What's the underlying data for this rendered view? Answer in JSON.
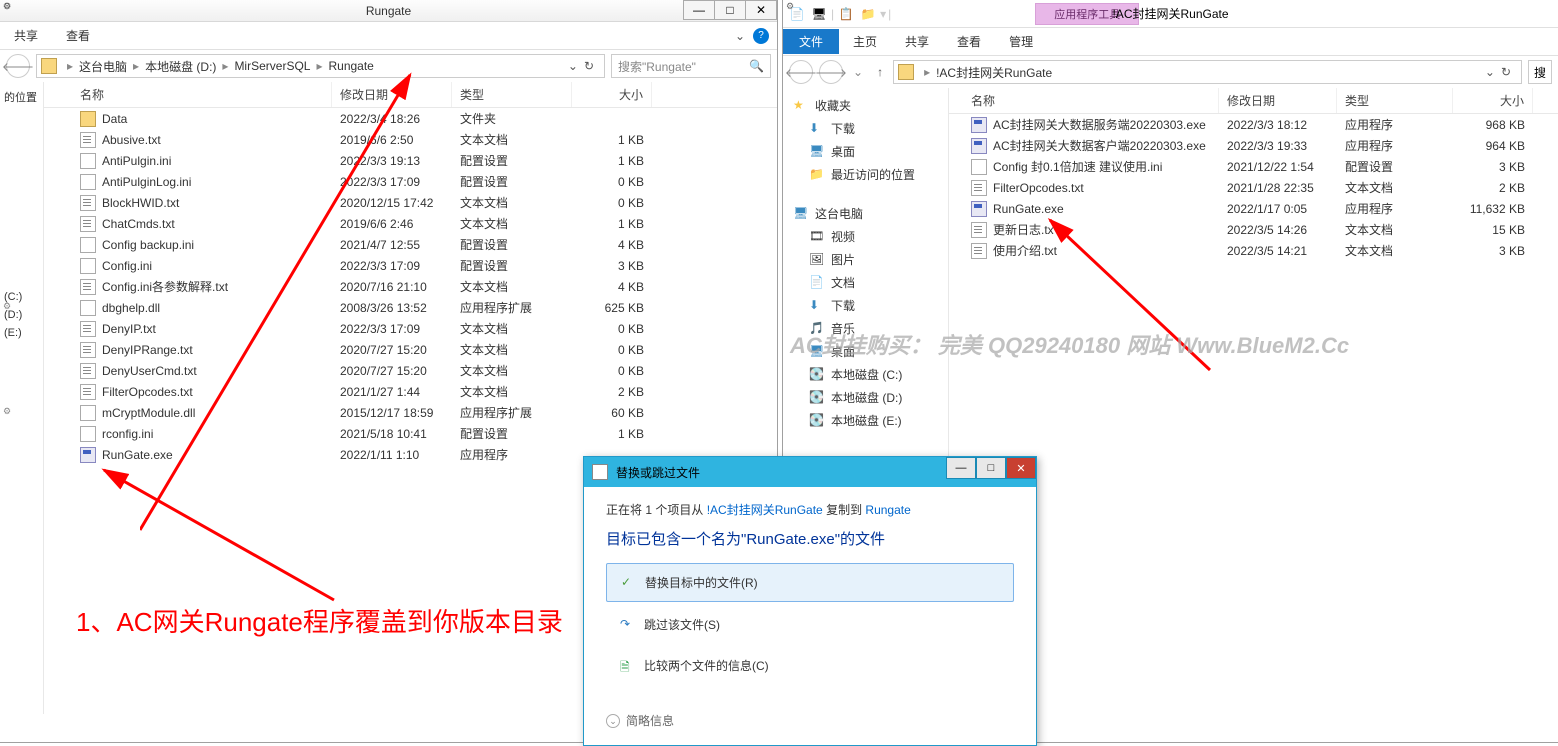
{
  "left_window": {
    "title": "Rungate",
    "menu": {
      "share": "共享",
      "view": "查看"
    },
    "breadcrumbs": [
      "这台电脑",
      "本地磁盘 (D:)",
      "MirServerSQL",
      "Rungate"
    ],
    "search_placeholder": "搜索\"Rungate\"",
    "columns": {
      "name": "名称",
      "date": "修改日期",
      "type": "类型",
      "size": "大小"
    },
    "left_stub": [
      "的位置",
      "(C:)",
      "(D:)",
      "(E:)"
    ],
    "files": [
      {
        "icon": "folder",
        "name": "Data",
        "date": "2022/3/4 18:26",
        "type": "文件夹",
        "size": ""
      },
      {
        "icon": "txt",
        "name": "Abusive.txt",
        "date": "2019/6/6 2:50",
        "type": "文本文档",
        "size": "1 KB"
      },
      {
        "icon": "ini",
        "name": "AntiPulgin.ini",
        "date": "2022/3/3 19:13",
        "type": "配置设置",
        "size": "1 KB"
      },
      {
        "icon": "ini",
        "name": "AntiPulginLog.ini",
        "date": "2022/3/3 17:09",
        "type": "配置设置",
        "size": "0 KB"
      },
      {
        "icon": "txt",
        "name": "BlockHWID.txt",
        "date": "2020/12/15 17:42",
        "type": "文本文档",
        "size": "0 KB"
      },
      {
        "icon": "txt",
        "name": "ChatCmds.txt",
        "date": "2019/6/6 2:46",
        "type": "文本文档",
        "size": "1 KB"
      },
      {
        "icon": "ini",
        "name": "Config backup.ini",
        "date": "2021/4/7 12:55",
        "type": "配置设置",
        "size": "4 KB"
      },
      {
        "icon": "ini",
        "name": "Config.ini",
        "date": "2022/3/3 17:09",
        "type": "配置设置",
        "size": "3 KB"
      },
      {
        "icon": "txt",
        "name": "Config.ini各参数解释.txt",
        "date": "2020/7/16 21:10",
        "type": "文本文档",
        "size": "4 KB"
      },
      {
        "icon": "dll",
        "name": "dbghelp.dll",
        "date": "2008/3/26 13:52",
        "type": "应用程序扩展",
        "size": "625 KB"
      },
      {
        "icon": "txt",
        "name": "DenyIP.txt",
        "date": "2022/3/3 17:09",
        "type": "文本文档",
        "size": "0 KB"
      },
      {
        "icon": "txt",
        "name": "DenyIPRange.txt",
        "date": "2020/7/27 15:20",
        "type": "文本文档",
        "size": "0 KB"
      },
      {
        "icon": "txt",
        "name": "DenyUserCmd.txt",
        "date": "2020/7/27 15:20",
        "type": "文本文档",
        "size": "0 KB"
      },
      {
        "icon": "txt",
        "name": "FilterOpcodes.txt",
        "date": "2021/1/27 1:44",
        "type": "文本文档",
        "size": "2 KB"
      },
      {
        "icon": "dll",
        "name": "mCryptModule.dll",
        "date": "2015/12/17 18:59",
        "type": "应用程序扩展",
        "size": "60 KB"
      },
      {
        "icon": "ini",
        "name": "rconfig.ini",
        "date": "2021/5/18 10:41",
        "type": "配置设置",
        "size": "1 KB"
      },
      {
        "icon": "exe",
        "name": "RunGate.exe",
        "date": "2022/1/11 1:10",
        "type": "应用程序",
        "size": ""
      }
    ]
  },
  "right_window": {
    "context_tab": "应用程序工具",
    "title": "!AC封挂网关RunGate",
    "menu": {
      "file": "文件",
      "home": "主页",
      "share": "共享",
      "view": "查看",
      "manage": "管理"
    },
    "address": "!AC封挂网关RunGate",
    "search_button": "搜",
    "columns": {
      "name": "名称",
      "date": "修改日期",
      "type": "类型",
      "size": "大小"
    },
    "sidebar": {
      "favorites": "收藏夹",
      "downloads": "下载",
      "desktop": "桌面",
      "recent": "最近访问的位置",
      "computer": "这台电脑",
      "videos": "视频",
      "pictures": "图片",
      "documents": "文档",
      "downloads2": "下载",
      "music": "音乐",
      "desktop2": "桌面",
      "diskC": "本地磁盘 (C:)",
      "diskD": "本地磁盘 (D:)",
      "diskE": "本地磁盘 (E:)"
    },
    "files": [
      {
        "icon": "exe",
        "name": "AC封挂网关大数据服务端20220303.exe",
        "date": "2022/3/3 18:12",
        "type": "应用程序",
        "size": "968 KB"
      },
      {
        "icon": "exe",
        "name": "AC封挂网关大数据客户端20220303.exe",
        "date": "2022/3/3 19:33",
        "type": "应用程序",
        "size": "964 KB"
      },
      {
        "icon": "ini",
        "name": "Config 封0.1倍加速 建议使用.ini",
        "date": "2021/12/22 1:54",
        "type": "配置设置",
        "size": "3 KB"
      },
      {
        "icon": "txt",
        "name": "FilterOpcodes.txt",
        "date": "2021/1/28 22:35",
        "type": "文本文档",
        "size": "2 KB"
      },
      {
        "icon": "exe",
        "name": "RunGate.exe",
        "date": "2022/1/17 0:05",
        "type": "应用程序",
        "size": "11,632 KB"
      },
      {
        "icon": "txt",
        "name": "更新日志.tx",
        "date": "2022/3/5 14:26",
        "type": "文本文档",
        "size": "15 KB"
      },
      {
        "icon": "txt",
        "name": "使用介绍.txt",
        "date": "2022/3/5 14:21",
        "type": "文本文档",
        "size": "3 KB"
      }
    ]
  },
  "dialog": {
    "title": "替换或跳过文件",
    "line1_pre": "正在将 1 个项目从 ",
    "line1_src": "!AC封挂网关RunGate",
    "line1_mid": " 复制到 ",
    "line1_dst": "Rungate",
    "heading": "目标已包含一个名为\"RunGate.exe\"的文件",
    "opt_replace": "替换目标中的文件(R)",
    "opt_skip": "跳过该文件(S)",
    "opt_compare": "比较两个文件的信息(C)",
    "footer": "简略信息"
  },
  "annotation": "1、AC网关Rungate程序覆盖到你版本目录",
  "watermark": "AC封挂购买： 完美 QQ29240180  网站 Www.BlueM2.Cc"
}
